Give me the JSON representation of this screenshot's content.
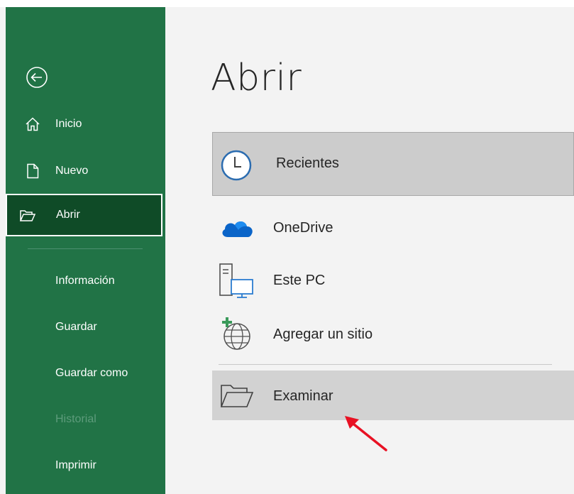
{
  "sidebar": {
    "back_icon": "back-arrow-circle-icon",
    "nav": [
      {
        "label": "Inicio",
        "icon": "home-icon"
      },
      {
        "label": "Nuevo",
        "icon": "new-document-icon"
      },
      {
        "label": "Abrir",
        "icon": "open-folder-icon",
        "active": true
      }
    ],
    "items": [
      {
        "label": "Información"
      },
      {
        "label": "Guardar"
      },
      {
        "label": "Guardar como"
      },
      {
        "label": "Historial",
        "disabled": true
      },
      {
        "label": "Imprimir"
      }
    ]
  },
  "main": {
    "title": "Abrir",
    "locations": [
      {
        "label": "Recientes",
        "icon": "clock-icon",
        "selected": true
      },
      {
        "label": "OneDrive",
        "icon": "onedrive-cloud-icon"
      },
      {
        "label": "Este PC",
        "icon": "computer-icon"
      },
      {
        "label": "Agregar un sitio",
        "icon": "add-place-globe-icon"
      },
      {
        "label": "Examinar",
        "icon": "browse-folder-icon"
      }
    ]
  },
  "colors": {
    "sidebar_bg": "#217346",
    "sidebar_active_bg": "#0f4b27",
    "annotation_arrow": "#e81123"
  }
}
